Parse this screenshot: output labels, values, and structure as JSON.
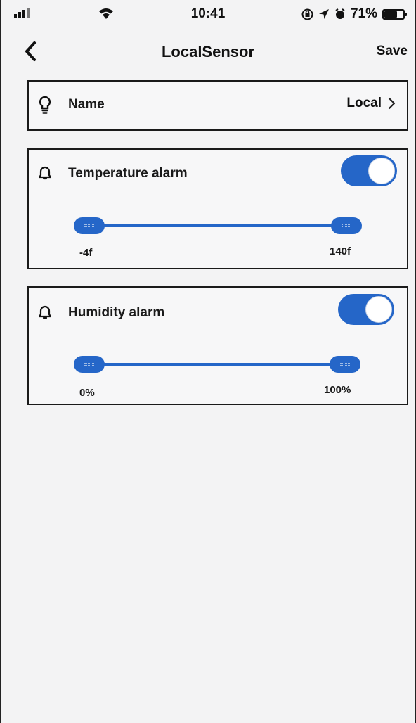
{
  "status_bar": {
    "time": "10:41",
    "battery_text": "71%",
    "battery_level": 0.71,
    "icons": [
      "signal-icon",
      "wifi-icon",
      "lock-rotation-icon",
      "location-icon",
      "alarm-icon",
      "battery-icon"
    ]
  },
  "nav": {
    "title": "LocalSensor",
    "save_label": "Save",
    "back_icon": "chevron-left-icon"
  },
  "name_row": {
    "label": "Name",
    "value": "Local",
    "icon": "lightbulb-icon",
    "chevron_icon": "chevron-right-icon"
  },
  "temperature_alarm": {
    "label": "Temperature alarm",
    "icon": "bell-icon",
    "enabled": true,
    "range_min_label": "-4f",
    "range_max_label": "140f",
    "low_value": -4,
    "high_value": 140
  },
  "humidity_alarm": {
    "label": "Humidity alarm",
    "icon": "bell-icon",
    "enabled": true,
    "range_min_label": "0%",
    "range_max_label": "100%",
    "low_value": 0,
    "high_value": 100
  },
  "colors": {
    "accent": "#2566c8",
    "background": "#f3f3f4",
    "text": "#1a1a1a"
  }
}
